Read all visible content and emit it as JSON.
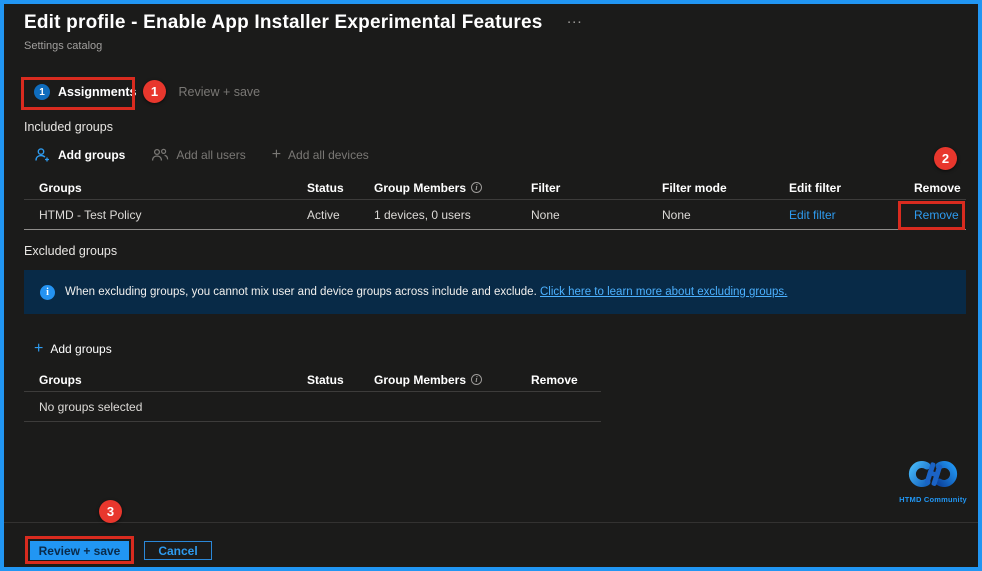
{
  "colors": {
    "accent": "#2196f3",
    "annotation_red": "#e8372d",
    "banner_bg": "#082a47",
    "primary_button_bg": "#2196f3"
  },
  "header": {
    "title": "Edit profile - Enable App Installer Experimental Features",
    "ellipsis": "...",
    "subtitle": "Settings catalog"
  },
  "tabs": {
    "assignments": {
      "step": "1",
      "label": "Assignments"
    },
    "review": {
      "label": "Review + save"
    }
  },
  "annotations": {
    "one": "1",
    "two": "2",
    "three": "3"
  },
  "included": {
    "heading": "Included groups",
    "toolbar": {
      "add_groups": "Add groups",
      "add_all_users": "Add all users",
      "add_all_devices": "Add all devices"
    },
    "table": {
      "headers": [
        "Groups",
        "Status",
        "Group Members",
        "Filter",
        "Filter mode",
        "Edit filter",
        "Remove"
      ],
      "rows": [
        {
          "group": "HTMD - Test Policy",
          "status": "Active",
          "members": "1 devices, 0 users",
          "filter": "None",
          "filter_mode": "None",
          "edit_filter": "Edit filter",
          "remove": "Remove"
        }
      ]
    }
  },
  "excluded": {
    "heading": "Excluded groups",
    "banner": {
      "text": "When excluding groups, you cannot mix user and device groups across include and exclude.",
      "link": "Click here to learn more about excluding groups."
    },
    "add_groups": "Add groups",
    "table": {
      "headers": [
        "Groups",
        "Status",
        "Group Members",
        "Remove"
      ],
      "empty": "No groups selected"
    }
  },
  "footer": {
    "review_save": "Review + save",
    "cancel": "Cancel"
  },
  "logo": {
    "caption": "HTMD Community"
  }
}
